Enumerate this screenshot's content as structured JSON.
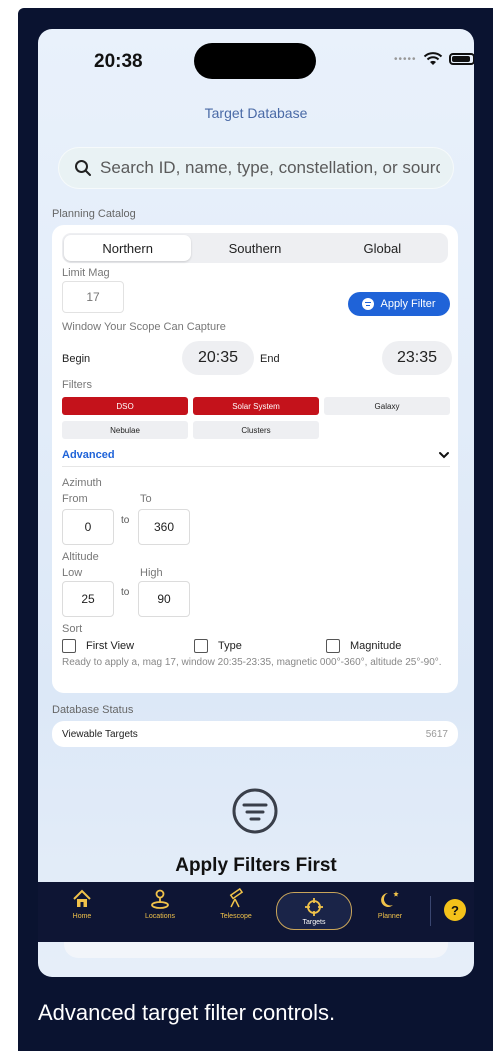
{
  "status": {
    "time": "20:38"
  },
  "header": {
    "title": "Target Database"
  },
  "search": {
    "placeholder": "Search ID, name, type, constellation, or source"
  },
  "planning": {
    "section_label": "Planning Catalog",
    "segments": [
      "Northern",
      "Southern",
      "Global"
    ],
    "selected_segment": "Northern",
    "limit_mag_label": "Limit Mag",
    "limit_mag_placeholder": "17",
    "apply_filter_label": "Apply Filter",
    "window_label": "Window Your Scope Can Capture",
    "begin_label": "Begin",
    "begin_time": "20:35",
    "end_label": "End",
    "end_time": "23:35",
    "filters_label": "Filters",
    "filters": [
      {
        "label": "DSO",
        "active": true
      },
      {
        "label": "Solar System",
        "active": true
      },
      {
        "label": "Galaxy",
        "active": false
      },
      {
        "label": "Nebulae",
        "active": false
      },
      {
        "label": "Clusters",
        "active": false
      }
    ],
    "advanced_label": "Advanced",
    "azimuth_label": "Azimuth",
    "az_from_label": "From",
    "az_to_label": "To",
    "az_from": "0",
    "az_to": "360",
    "altitude_label": "Altitude",
    "alt_low_label": "Low",
    "alt_high_label": "High",
    "alt_low": "25",
    "alt_high": "90",
    "to_word": "to",
    "sort_label": "Sort",
    "sort_options": [
      "First View",
      "Type",
      "Magnitude"
    ],
    "summary": "Ready to apply a, mag 17, window 20:35-23:35, magnetic 000°-360°, altitude 25°-90°."
  },
  "database": {
    "section_label": "Database Status",
    "row_name": "Viewable Targets",
    "row_value": "5617"
  },
  "empty_state": {
    "title": "Apply Filters First"
  },
  "tabs": [
    {
      "label": "Home",
      "icon": "home-icon"
    },
    {
      "label": "Locations",
      "icon": "location-pin-icon"
    },
    {
      "label": "Telescope",
      "icon": "telescope-icon"
    },
    {
      "label": "Targets",
      "icon": "crosshair-icon",
      "active": true
    },
    {
      "label": "Planner",
      "icon": "moon-star-icon"
    }
  ],
  "help_label": "?",
  "caption": "Advanced target filter controls.",
  "colors": {
    "accent": "#1f63d8",
    "chip_active": "#c4121b",
    "tab_gold": "#f0c24a",
    "tabbar_bg": "#0e1534"
  }
}
